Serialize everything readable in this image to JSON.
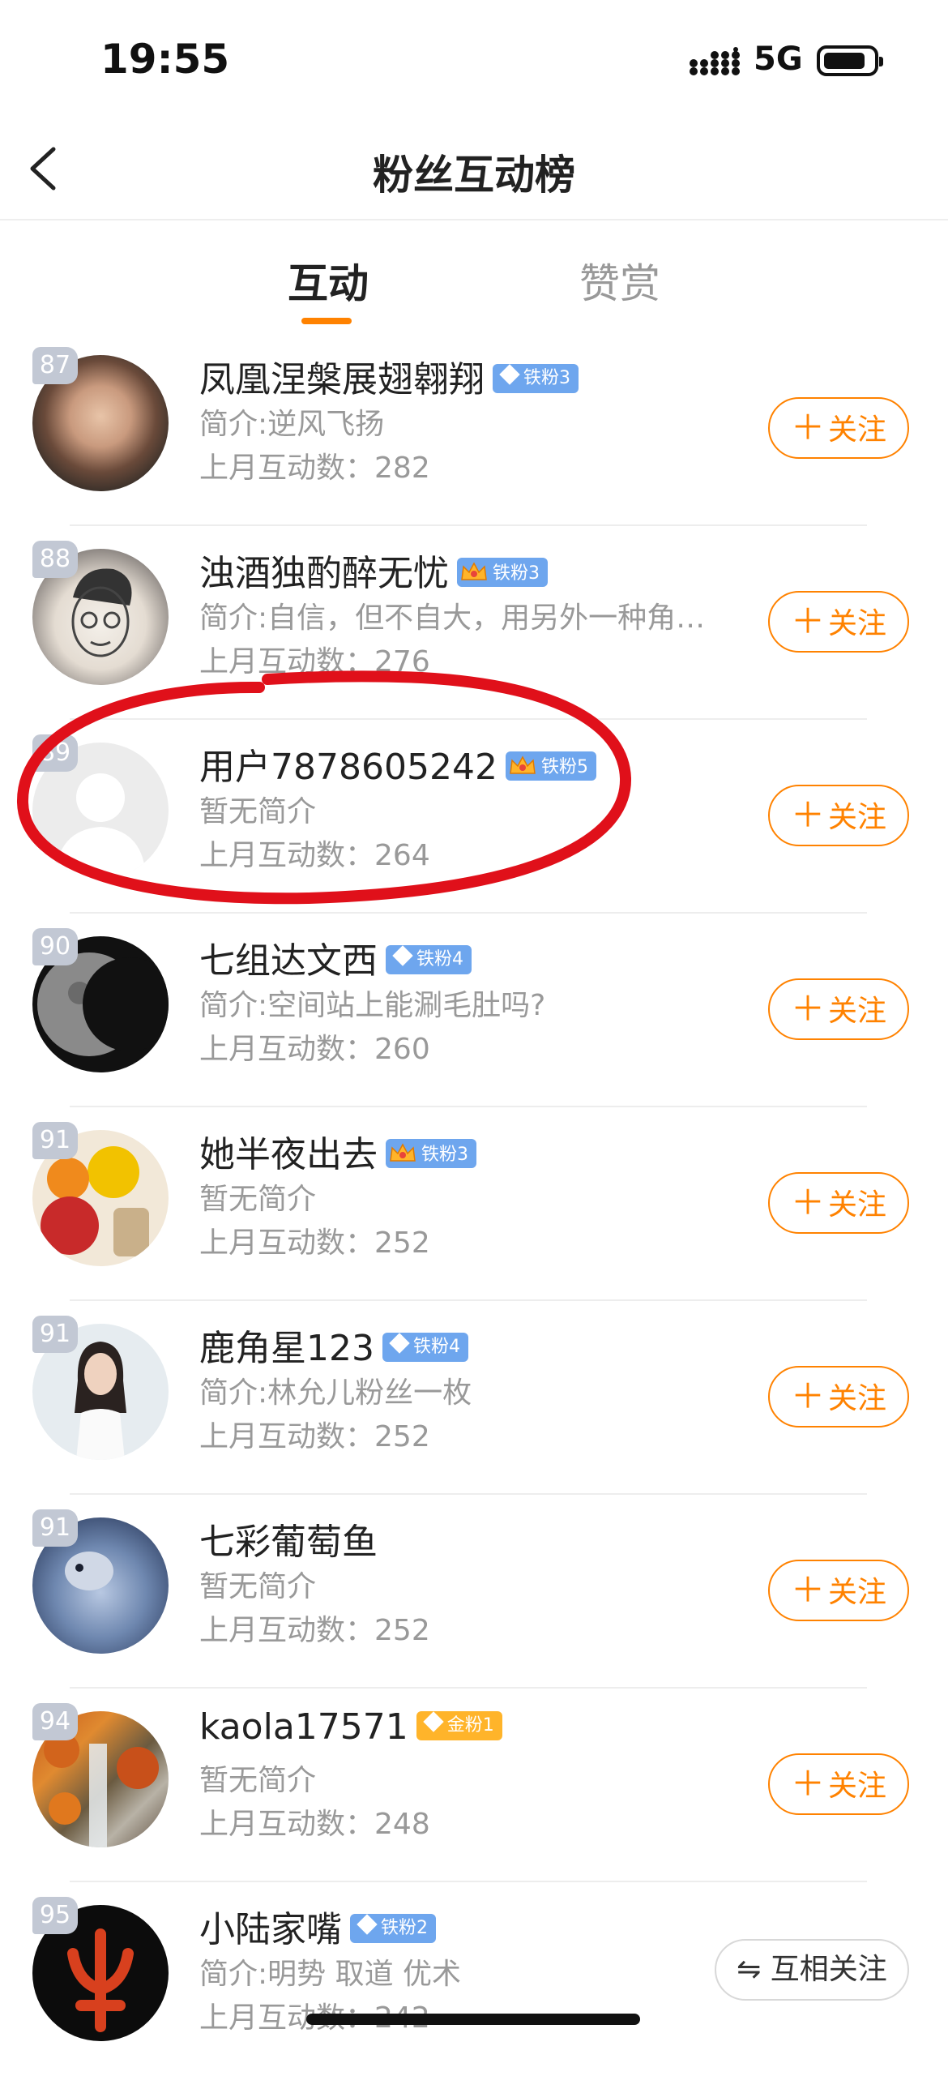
{
  "status_bar": {
    "time": "19:55",
    "network": "5G"
  },
  "header": {
    "title": "粉丝互动榜"
  },
  "tabs": [
    {
      "label": "互动",
      "active": true
    },
    {
      "label": "赞赏",
      "active": false
    }
  ],
  "colors": {
    "accent": "#ff8200",
    "iron_badge": "#6ea6ee",
    "gold_badge": "#ffb42a",
    "annotation": "#e0101a"
  },
  "count_label": "上月互动数：",
  "follow_label": "关注",
  "mutual_label": "互相关注",
  "fans": [
    {
      "rank": "87",
      "name": "凤凰涅槃展翅翱翔",
      "badge": "铁粉3",
      "badge_icon": "diamond",
      "intro": "简介:逆风飞扬",
      "count": "282",
      "button": "follow"
    },
    {
      "rank": "88",
      "name": "浊酒独酌醉无忧",
      "badge": "铁粉3",
      "badge_icon": "crown",
      "intro": "简介:自信，但不自大，用另外一种角度看世界",
      "count": "276",
      "button": "follow"
    },
    {
      "rank": "89",
      "name": "用户7878605242",
      "badge": "铁粉5",
      "badge_icon": "crown",
      "intro": "暂无简介",
      "count": "264",
      "button": "follow"
    },
    {
      "rank": "90",
      "name": "七组达文西",
      "badge": "铁粉4",
      "badge_icon": "diamond",
      "intro": "简介:空间站上能涮毛肚吗?",
      "count": "260",
      "button": "follow"
    },
    {
      "rank": "91",
      "name": "她半夜出去",
      "badge": "铁粉3",
      "badge_icon": "crown",
      "intro": "暂无简介",
      "count": "252",
      "button": "follow"
    },
    {
      "rank": "91",
      "name": "鹿角星123",
      "badge": "铁粉4",
      "badge_icon": "diamond",
      "intro": "简介:林允儿粉丝一枚",
      "count": "252",
      "button": "follow"
    },
    {
      "rank": "91",
      "name": "七彩葡萄鱼",
      "badge": "",
      "badge_icon": "",
      "intro": "暂无简介",
      "count": "252",
      "button": "follow"
    },
    {
      "rank": "94",
      "name": "kaola17571",
      "badge": "金粉1",
      "badge_icon": "gold",
      "intro": "暂无简介",
      "count": "248",
      "button": "follow"
    },
    {
      "rank": "95",
      "name": "小陆家嘴",
      "badge": "铁粉2",
      "badge_icon": "diamond",
      "intro": "简介:明势 取道 优术",
      "count": "242",
      "button": "mutual"
    }
  ]
}
